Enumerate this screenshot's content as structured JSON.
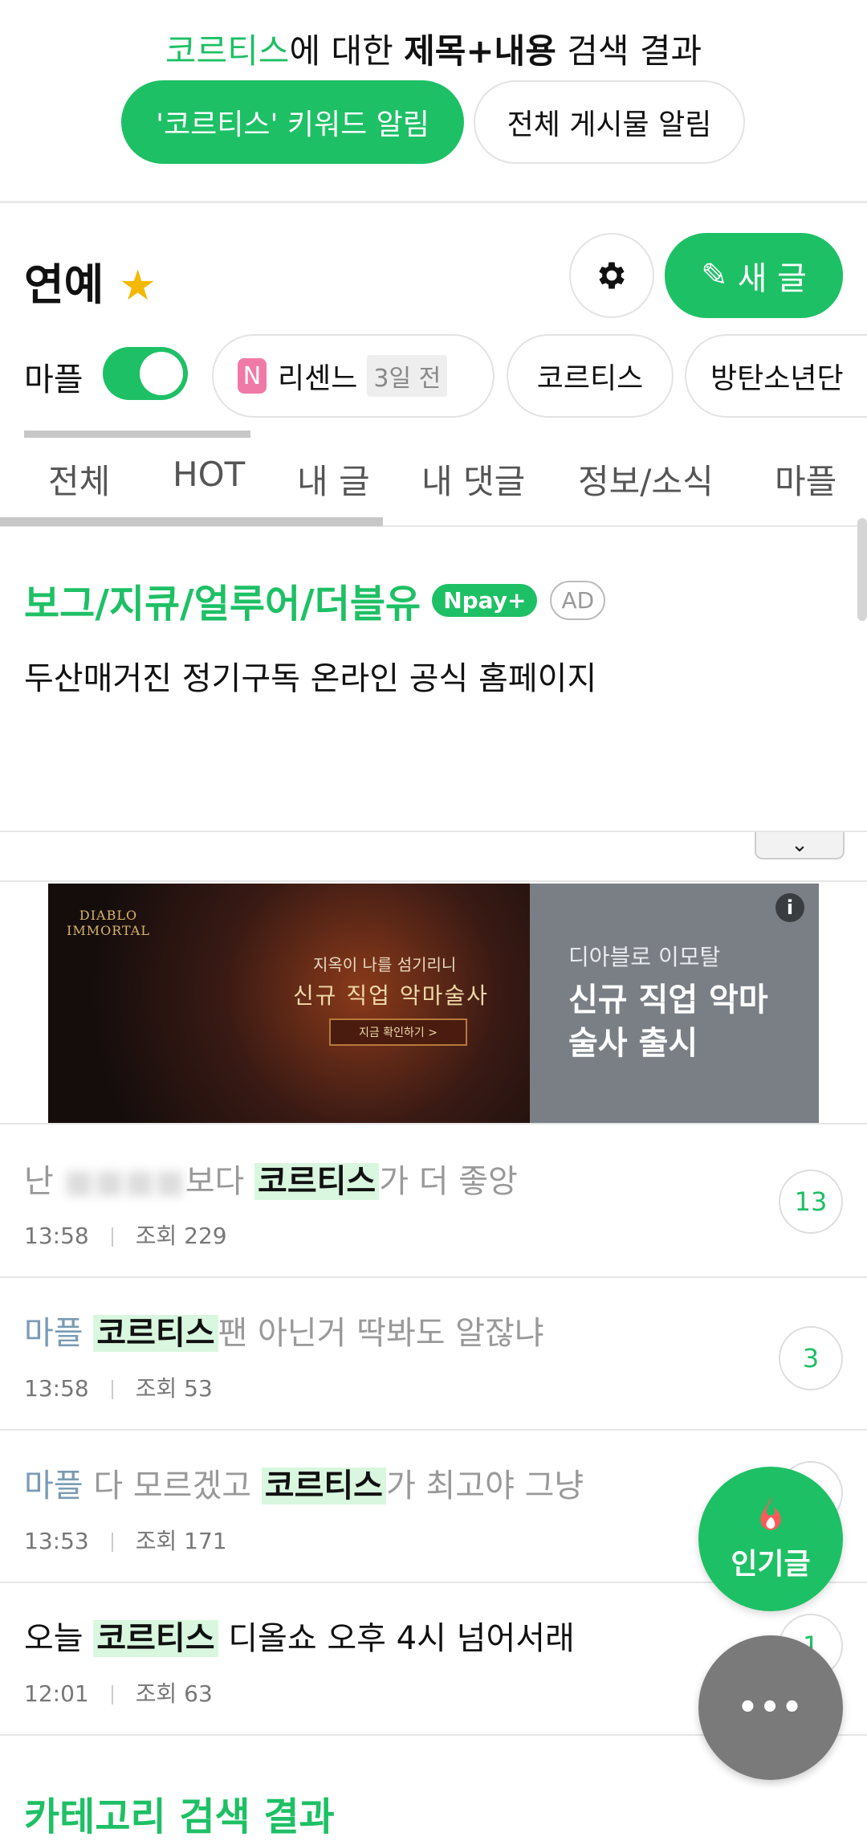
{
  "search_header": {
    "keyword": "코르티스",
    "middle": "에 대한 ",
    "scope": "제목+내용",
    "suffix": " 검색 결과",
    "keyword_alert_button": "'코르티스' 키워드 알림",
    "all_posts_alert_button": "전체 게시물 알림"
  },
  "board": {
    "title": "연예",
    "new_post_button": "새 글",
    "mapl_label": "마플",
    "mapl_toggle_on": true,
    "chips": [
      {
        "badge": "N",
        "label": "리센느",
        "time": "3일 전"
      },
      {
        "label": "코르티스"
      },
      {
        "label": "방탄소년단"
      }
    ],
    "tabs": [
      "전체",
      "HOT",
      "내 글",
      "내 댓글",
      "정보/소식",
      "마플"
    ]
  },
  "text_ad": {
    "title": "보그/지큐/얼루어/더블유",
    "pay_badge": "Npay+",
    "ad_badge": "AD",
    "description": "두산매거진 정기구독 온라인 공식 홈페이지"
  },
  "banner_ad": {
    "logo": "DIABLO IMMORTAL",
    "image_tagline": "지옥이 나를 섬기리니",
    "image_headline": "신규 직업 악마술사",
    "image_cta": "지금 확인하기 >",
    "advertiser": "디아블로 이모탈",
    "headline": "신규 직업 악마술사 출시",
    "info_icon": "info-icon"
  },
  "posts": [
    {
      "prefix": "난 ",
      "blur": "■■■■",
      "before": "보다 ",
      "keyword": "코르티스",
      "after": "가 더 좋앙",
      "time": "13:58",
      "views": "조회 229",
      "comments": "13",
      "read": false
    },
    {
      "category": "마플",
      "keyword": "코르티스",
      "after": "팬 아닌거 딱봐도 알잖냐",
      "time": "13:58",
      "views": "조회 53",
      "comments": "3",
      "read": false
    },
    {
      "category": "마플",
      "before": " 다 모르겠고 ",
      "keyword": "코르티스",
      "after": "가 최고야 그냥",
      "time": "13:53",
      "views": "조회 171",
      "comments": "",
      "read": false
    },
    {
      "before": "오늘 ",
      "keyword": "코르티스",
      "after": " 디올쇼 오후 4시 넘어서래",
      "time": "12:01",
      "views": "조회 63",
      "comments": "1",
      "read": true
    }
  ],
  "category_section_title": "카테고리 검색 결과",
  "fab": {
    "popular_label": "인기글",
    "more_icon": "more-dots-icon"
  },
  "colors": {
    "accent": "#1ec065",
    "highlight": "#d9f7df",
    "category": "#7a9bb3",
    "fab_gray": "#7a7a7a"
  }
}
